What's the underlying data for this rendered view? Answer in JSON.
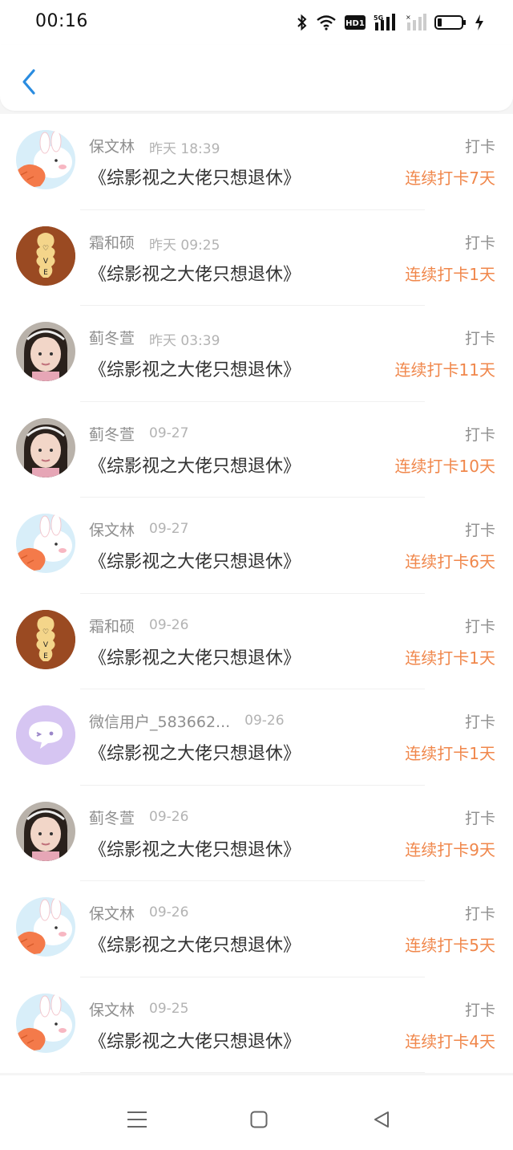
{
  "status_bar": {
    "time": "00:16",
    "icons": [
      "bluetooth-icon",
      "wifi-icon",
      "hd-icon",
      "signal-5g-icon",
      "signal-off-icon",
      "battery-icon",
      "charging-icon"
    ],
    "hd_label": "HD1",
    "network_label": "5G"
  },
  "header": {
    "back_icon": "chevron-left-icon",
    "accent": "#2a8ce0"
  },
  "action_label": "打卡",
  "streak_color": "#f0874b",
  "items": [
    {
      "name": "保文林",
      "time": "昨天 18:39",
      "title": "《综影视之大佬只想退休》",
      "action": "打卡",
      "streak": "连续打卡7天",
      "avatar": "bunny"
    },
    {
      "name": "霜和硕",
      "time": "昨天 09:25",
      "title": "《综影视之大佬只想退休》",
      "action": "打卡",
      "streak": "连续打卡1天",
      "avatar": "love"
    },
    {
      "name": "蓟冬萱",
      "time": "昨天 03:39",
      "title": "《综影视之大佬只想退休》",
      "action": "打卡",
      "streak": "连续打卡11天",
      "avatar": "girl"
    },
    {
      "name": "蓟冬萱",
      "time": "09-27",
      "title": "《综影视之大佬只想退休》",
      "action": "打卡",
      "streak": "连续打卡10天",
      "avatar": "girl"
    },
    {
      "name": "保文林",
      "time": "09-27",
      "title": "《综影视之大佬只想退休》",
      "action": "打卡",
      "streak": "连续打卡6天",
      "avatar": "bunny"
    },
    {
      "name": "霜和硕",
      "time": "09-26",
      "title": "《综影视之大佬只想退休》",
      "action": "打卡",
      "streak": "连续打卡1天",
      "avatar": "love"
    },
    {
      "name": "微信用户_583662...",
      "time": "09-26",
      "title": "《综影视之大佬只想退休》",
      "action": "打卡",
      "streak": "连续打卡1天",
      "avatar": "wechat"
    },
    {
      "name": "蓟冬萱",
      "time": "09-26",
      "title": "《综影视之大佬只想退休》",
      "action": "打卡",
      "streak": "连续打卡9天",
      "avatar": "girl"
    },
    {
      "name": "保文林",
      "time": "09-26",
      "title": "《综影视之大佬只想退休》",
      "action": "打卡",
      "streak": "连续打卡5天",
      "avatar": "bunny"
    },
    {
      "name": "保文林",
      "time": "09-25",
      "title": "《综影视之大佬只想退休》",
      "action": "打卡",
      "streak": "连续打卡4天",
      "avatar": "bunny"
    }
  ],
  "nav_bar": {
    "buttons": [
      "menu-icon",
      "home-square-icon",
      "back-triangle-icon"
    ]
  }
}
